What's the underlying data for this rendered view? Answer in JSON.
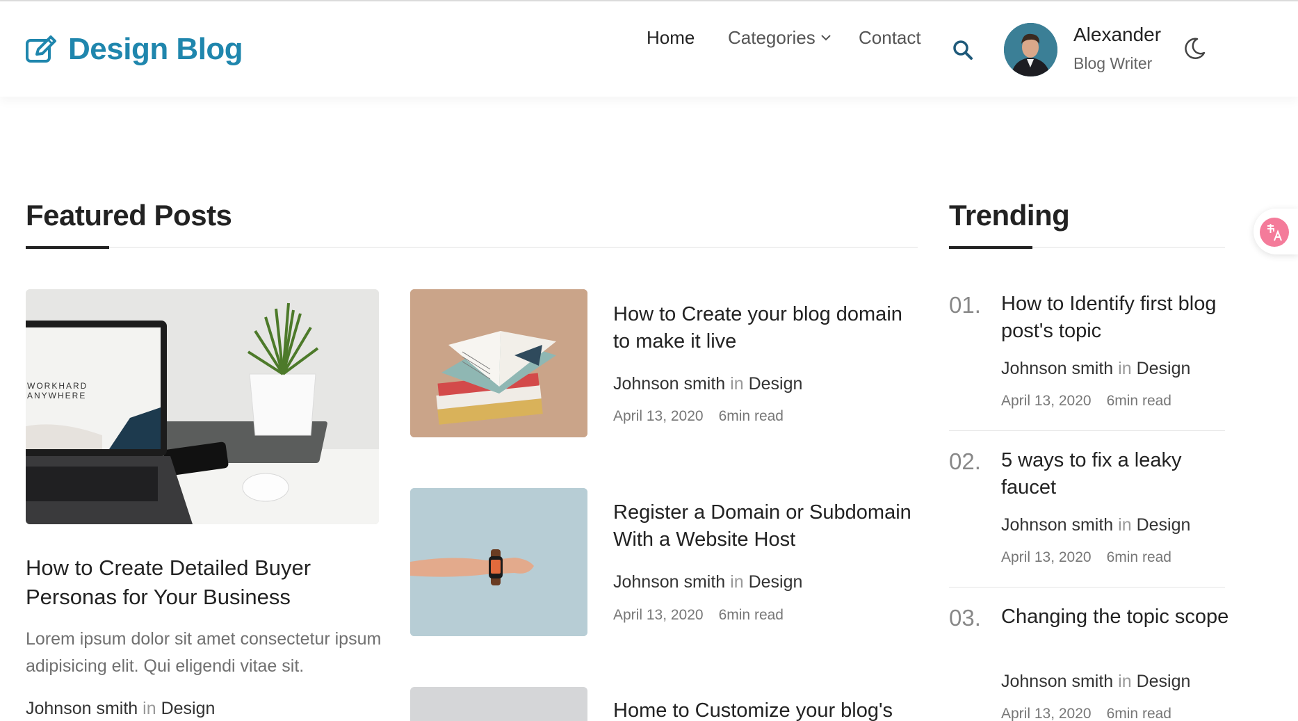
{
  "header": {
    "logo_text": "Design Blog",
    "nav": {
      "home": "Home",
      "categories": "Categories",
      "contact": "Contact"
    },
    "user": {
      "name": "Alexander",
      "role": "Blog Writer"
    }
  },
  "featured": {
    "heading": "Featured Posts",
    "main_post": {
      "image_text_line1": "WORKHARD",
      "image_text_line2": "ANYWHERE",
      "title": "How to Create Detailed Buyer Personas for Your Business",
      "excerpt": "Lorem ipsum dolor sit amet consectetur ipsum adipisicing elit. Qui eligendi vitae sit.",
      "author": "Johnson smith",
      "in": "in",
      "category": "Design"
    },
    "side_posts": [
      {
        "title": "How to Create your blog domain to make it live",
        "author": "Johnson smith",
        "in": "in",
        "category": "Design",
        "date": "April 13, 2020",
        "read": "6min read"
      },
      {
        "title": "Register a Domain or Subdomain With a Website Host",
        "author": "Johnson smith",
        "in": "in",
        "category": "Design",
        "date": "April 13, 2020",
        "read": "6min read"
      },
      {
        "title": "Home to Customize your blog's"
      }
    ]
  },
  "trending": {
    "heading": "Trending",
    "items": [
      {
        "num": "01.",
        "title": "How to Identify first blog post's topic",
        "author": "Johnson smith",
        "in": "in",
        "category": "Design",
        "date": "April 13, 2020",
        "read": "6min read"
      },
      {
        "num": "02.",
        "title": "5 ways to fix a leaky faucet",
        "author": "Johnson smith",
        "in": "in",
        "category": "Design",
        "date": "April 13, 2020",
        "read": "6min read"
      },
      {
        "num": "03.",
        "title": "Changing the topic scope",
        "author": "Johnson smith",
        "in": "in",
        "category": "Design",
        "date": "April 13, 2020",
        "read": "6min read"
      }
    ]
  },
  "translate_widget": {
    "icon": "translate-icon"
  },
  "colors": {
    "brand": "#1f86ad",
    "text": "#222222",
    "muted": "#777777",
    "translate": "#f47b9a"
  }
}
